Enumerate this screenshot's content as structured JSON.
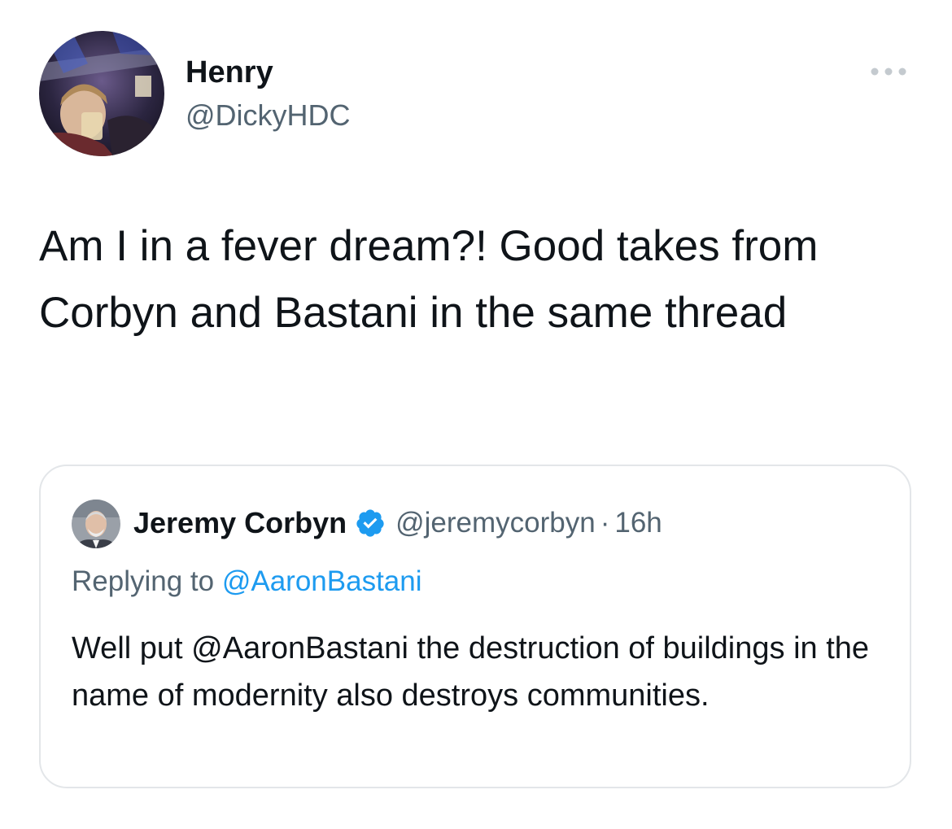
{
  "tweet": {
    "author": {
      "name": "Henry",
      "handle": "@DickyHDC",
      "avatar_icon": "profile-photo"
    },
    "more_icon": "ellipsis-icon",
    "text": "Am I in a fever dream?! Good takes from Corbyn and Bastani in the same thread"
  },
  "quoted_tweet": {
    "author": {
      "name": "Jeremy Corbyn",
      "handle": "@jeremycorbyn",
      "verified": true,
      "avatar_icon": "profile-photo"
    },
    "separator": "·",
    "time": "16h",
    "replying_prefix": "Replying to",
    "replying_to": "@AaronBastani",
    "text_prefix": "Well put",
    "mention": "@AaronBastani",
    "text_suffix": "the destruction of buildings in the name of modernity also destroys communities."
  },
  "colors": {
    "text_primary": "#0f1419",
    "text_secondary": "#536471",
    "link": "#1d9bf0",
    "border": "#e3e6e9",
    "verified": "#1d9bf0"
  }
}
